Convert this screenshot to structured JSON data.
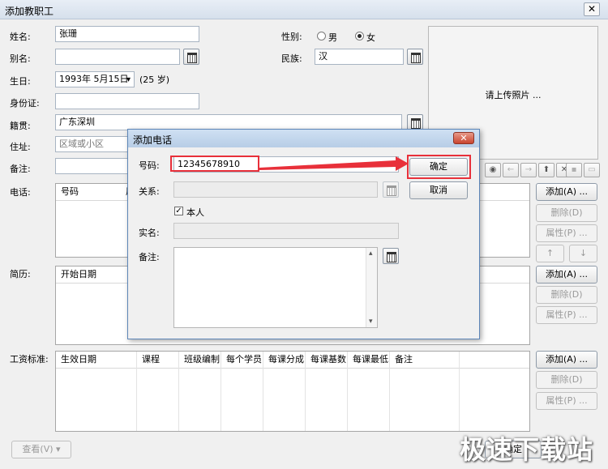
{
  "window": {
    "title": "添加教职工",
    "close_glyph": "✕"
  },
  "form": {
    "name_label": "姓名:",
    "name_value": "张珊",
    "alias_label": "别名:",
    "alias_value": "",
    "birthday_label": "生日:",
    "birthday_value": "1993年 5月15日",
    "age_text": "(25 岁)",
    "idcard_label": "身份证:",
    "idcard_value": "",
    "origin_label": "籍贯:",
    "origin_value": "广东深圳",
    "address_label": "住址:",
    "address_placeholder": "区域或小区",
    "note_label": "备注:",
    "note_value": "",
    "gender_label": "性别:",
    "gender_male": "男",
    "gender_female": "女",
    "gender_selected": "女",
    "ethnic_label": "民族:",
    "ethnic_value": "汉"
  },
  "photo": {
    "text": "请上传照片 ..."
  },
  "phone_section": {
    "label": "电话:",
    "columns": [
      "号码",
      "属"
    ],
    "buttons": {
      "add": "添加(A) ...",
      "delete": "删除(D)",
      "properties": "属性(P) ...",
      "up": "↑",
      "down": "↓"
    }
  },
  "resume_section": {
    "label": "简历:",
    "columns": [
      "开始日期"
    ],
    "buttons": {
      "add": "添加(A) ...",
      "delete": "删除(D)",
      "properties": "属性(P) ..."
    }
  },
  "salary_section": {
    "label": "工资标准:",
    "columns": [
      "生效日期",
      "课程",
      "班级编制",
      "每个学员",
      "每课分成",
      "每课基数",
      "每课最低",
      "备注"
    ],
    "buttons": {
      "add": "添加(A) ...",
      "delete": "删除(D)",
      "properties": "属性(P) ..."
    }
  },
  "toolbar_icons": [
    "eye-icon",
    "arrow-left-icon",
    "arrow-right-icon",
    "upload-icon",
    "delete-icon",
    "save-icon",
    "comment-icon"
  ],
  "toolbar_glyphs": {
    "eye": "◉",
    "left": "←",
    "right": "→",
    "upload": "⬆",
    "delete": "✕",
    "save": "▪",
    "comment": "▭"
  },
  "footer": {
    "view_button": "查看(V)",
    "view_arrow": "▾",
    "ok_button": "确定"
  },
  "dialog": {
    "title": "添加电话",
    "close_glyph": "✕",
    "number_label": "号码:",
    "number_value": "12345678910",
    "relation_label": "关系:",
    "relation_value": "",
    "self_checkbox_label": "本人",
    "self_checked": true,
    "check_glyph": "✓",
    "realname_label": "实名:",
    "realname_value": "",
    "note_label": "备注:",
    "note_value": "",
    "ok_button": "确定",
    "cancel_button": "取消",
    "scroll_up": "▴",
    "scroll_down": "▾"
  },
  "date_dropdown_arrow": "▾",
  "watermark": "极速下载站",
  "colors": {
    "highlight_red": "#e8303a",
    "titlebar": "#d6e0ec"
  }
}
